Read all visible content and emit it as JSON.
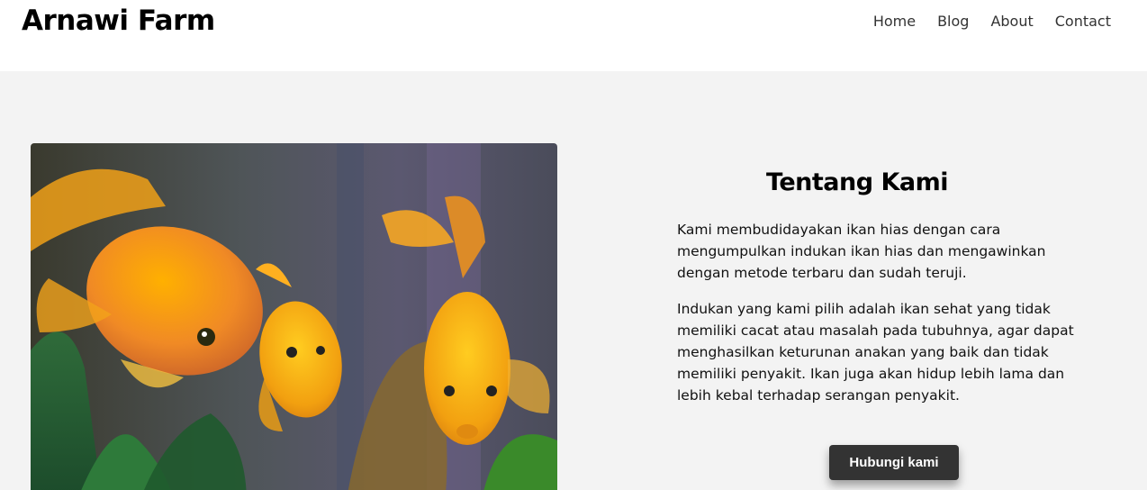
{
  "header": {
    "brand": "Arnawi Farm",
    "nav": [
      "Home",
      "Blog",
      "About",
      "Contact"
    ]
  },
  "about": {
    "title": "Tentang Kami",
    "paragraphs": [
      "Kami membudidayakan ikan hias dengan cara mengumpulkan indukan ikan hias dan mengawinkan dengan metode terbaru dan sudah teruji.",
      "Indukan yang kami pilih adalah ikan sehat yang tidak memiliki cacat atau masalah pada tubuhnya, agar dapat menghasilkan keturunan anakan yang baik dan tidak memiliki penyakit. Ikan juga akan hidup lebih lama dan lebih kebal terhadap serangan penyakit."
    ],
    "cta_label": "Hubungi kami"
  },
  "colors": {
    "header_bg": "#ffffff",
    "page_bg": "#f3f3f3",
    "button_bg": "#333333",
    "fish_orange": "#f5a623"
  },
  "icons": {
    "hero_image": "goldfish-aquarium-photo"
  }
}
